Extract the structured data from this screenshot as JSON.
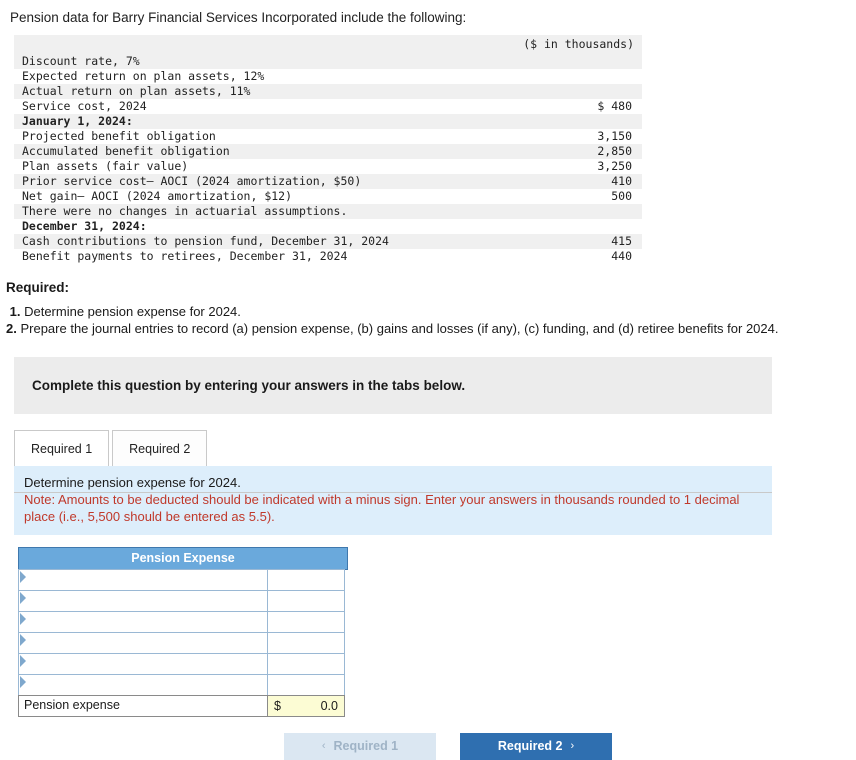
{
  "intro": "Pension data for Barry Financial Services Incorporated include the following:",
  "table": {
    "units_header": "($ in thousands)",
    "rows": [
      {
        "label": "Discount rate, 7%",
        "amount": "",
        "shade": true,
        "bold": false
      },
      {
        "label": "Expected return on plan assets, 12%",
        "amount": "",
        "shade": false,
        "bold": false
      },
      {
        "label": "Actual return on plan assets, 11%",
        "amount": "",
        "shade": true,
        "bold": false
      },
      {
        "label": "Service cost, 2024",
        "amount": "$ 480",
        "shade": false,
        "bold": false
      },
      {
        "label": "January 1, 2024:",
        "amount": "",
        "shade": true,
        "bold": true
      },
      {
        "label": "Projected benefit obligation",
        "amount": "3,150",
        "shade": false,
        "bold": false
      },
      {
        "label": "Accumulated benefit obligation",
        "amount": "2,850",
        "shade": true,
        "bold": false
      },
      {
        "label": "Plan assets (fair value)",
        "amount": "3,250",
        "shade": false,
        "bold": false
      },
      {
        "label": "Prior service cost– AOCI (2024 amortization, $50)",
        "amount": "410",
        "shade": true,
        "bold": false
      },
      {
        "label": "Net gain– AOCI (2024 amortization, $12)",
        "amount": "500",
        "shade": false,
        "bold": false
      },
      {
        "label": "There were no changes in actuarial assumptions.",
        "amount": "",
        "shade": true,
        "bold": false
      },
      {
        "label": "December 31, 2024:",
        "amount": "",
        "shade": false,
        "bold": true
      },
      {
        "label": "Cash contributions to pension fund, December 31, 2024",
        "amount": "415",
        "shade": true,
        "bold": false
      },
      {
        "label": "Benefit payments to retirees, December 31, 2024",
        "amount": "440",
        "shade": false,
        "bold": false
      }
    ]
  },
  "required": {
    "heading": "Required:",
    "item1_num": "1.",
    "item1_text": "Determine pension expense for 2024.",
    "item2_num": "2.",
    "item2_text": "Prepare the journal entries to record (a) pension expense, (b) gains and losses (if any), (c) funding, and (d) retiree benefits for 2024."
  },
  "grey_band": {
    "text": "Complete this question by entering your answers in the tabs below."
  },
  "tabs": [
    {
      "label": "Required 1",
      "active": true
    },
    {
      "label": "Required 2",
      "active": false
    }
  ],
  "note": {
    "line1": "Determine pension expense for 2024.",
    "line2": "Note: Amounts to be deducted should be indicated with a minus sign. Enter your answers in thousands rounded to 1 decimal place (i.e., 5,500 should be entered as 5.5)."
  },
  "answer_grid": {
    "header": "Pension Expense",
    "blank_rows": 6,
    "total_label": "Pension expense",
    "total_currency": "$",
    "total_value": "0.0"
  },
  "nav": {
    "prev_label": "Required 1",
    "prev_chevron": "‹",
    "next_label": "Required 2",
    "next_chevron": "›"
  },
  "colors": {
    "accent_blue": "#2f6fb0",
    "table_header_blue": "#6aa9dc",
    "note_bg": "#ddeefb",
    "note_red": "#c0392b",
    "total_bg": "#fcfcd4"
  }
}
